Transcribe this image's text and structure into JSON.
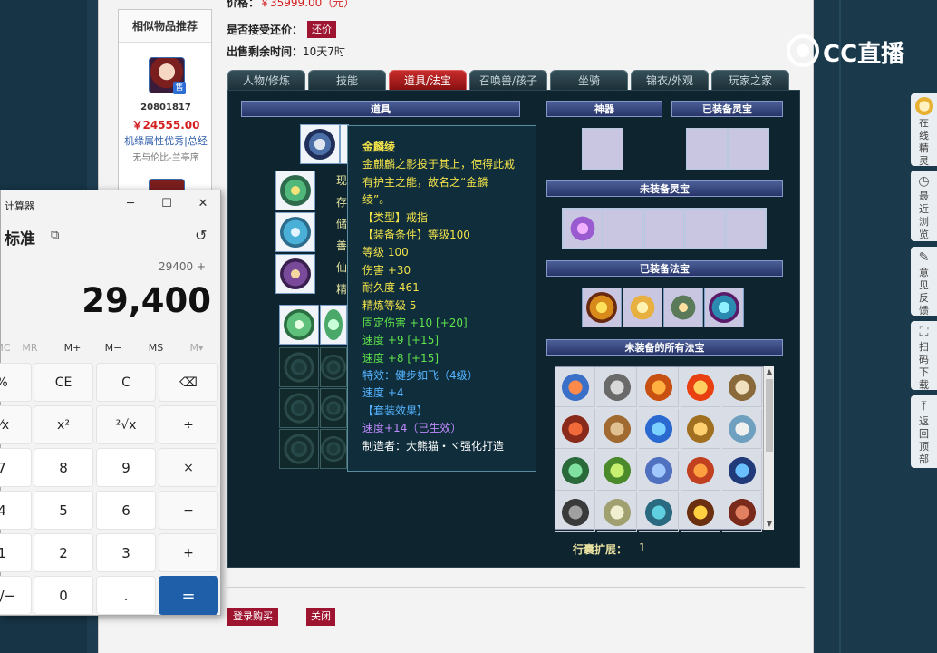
{
  "page": {
    "price_label": "价格：",
    "price_value": "￥35999.00（元）",
    "bargain_label": "是否接受还价：",
    "bargain_button": "还价",
    "time_label": "出售剩余时间：",
    "time_value": "10天7时"
  },
  "similar": {
    "title": "相似物品推荐",
    "badge": "售",
    "id": "20801817",
    "price": "￥24555.00",
    "desc": "机缘属性优秀|总经",
    "server": "无与伦比-兰亭序"
  },
  "tabs": [
    "人物/修炼",
    "技能",
    "道具/法宝",
    "召唤兽/孩子",
    "坐骑",
    "锦衣/外观",
    "玩家之家"
  ],
  "sections": {
    "items": "道具",
    "artifact": "神器",
    "equipped_spirit": "已装备灵宝",
    "unequipped_spirit": "未装备灵宝",
    "equipped_magic": "已装备法宝",
    "all_magic": "未装备的所有法宝",
    "bag_label": "行囊扩展：",
    "bag_value": "1"
  },
  "under_text": [
    "现",
    "存",
    "储",
    "善",
    "仙",
    "精"
  ],
  "tooltip": {
    "lines": [
      {
        "text": "金麟绫",
        "color": "yellow"
      },
      {
        "text": "金麒麟之影投于其上，使得此戒",
        "color": "yellow"
      },
      {
        "text": "有护主之能，故名之“金麟",
        "color": "yellow"
      },
      {
        "text": "绫”。",
        "color": "yellow"
      },
      {
        "text": "【类型】戒指",
        "color": "yellow"
      },
      {
        "text": "【装备条件】等级100",
        "color": "yellow"
      },
      {
        "text": "等级 100",
        "color": "yellow"
      },
      {
        "text": "伤害 +30",
        "color": "yellow"
      },
      {
        "text": "耐久度 461",
        "color": "yellow"
      },
      {
        "text": "精炼等级 5",
        "color": "yellow"
      },
      {
        "text": "固定伤害 +10 [+20]",
        "color": "green"
      },
      {
        "text": "速度 +9 [+15]",
        "color": "green"
      },
      {
        "text": "速度 +8 [+15]",
        "color": "green"
      },
      {
        "text": "特效：健步如飞（4级）",
        "color": "blue"
      },
      {
        "text": "速度 +4",
        "color": "blue"
      },
      {
        "text": "【套装效果】",
        "color": "blue"
      },
      {
        "text": "速度+14（已生效）",
        "color": "purple"
      },
      {
        "text": "制造者：大熊猫・ヾ强化打造",
        "color": "white"
      }
    ]
  },
  "buttons": {
    "login_buy": "登录购买",
    "close": "关闭"
  },
  "sidebar": [
    {
      "label": "在线精灵",
      "icon": "avatar-icon"
    },
    {
      "label": "最近浏览",
      "icon": "clock-icon"
    },
    {
      "label": "意见反馈",
      "icon": "edit-icon"
    },
    {
      "label": "扫码下载",
      "icon": "scan-icon"
    },
    {
      "label": "返回顶部",
      "icon": "arrow-up-icon"
    }
  ],
  "watermark": "CC直播",
  "calculator": {
    "title": "计算器",
    "mode": "标准",
    "expression": "29400 +",
    "display": "29,400",
    "memory": [
      "MC",
      "MR",
      "M+",
      "M−",
      "MS",
      "M▾"
    ],
    "keys": [
      "%",
      "CE",
      "C",
      "⌫",
      "⅟x",
      "x²",
      "²√x",
      "÷",
      "7",
      "8",
      "9",
      "×",
      "4",
      "5",
      "6",
      "−",
      "1",
      "2",
      "3",
      "+",
      "+/−",
      "0",
      ".",
      "="
    ]
  },
  "colors": {
    "accent_red": "#9e1430",
    "panel_bg": "#0e2530",
    "tooltip_yellow": "#f2e24a",
    "tooltip_green": "#5fe24a",
    "tooltip_blue": "#54b4ff",
    "calc_equal": "#1f5ea8"
  }
}
